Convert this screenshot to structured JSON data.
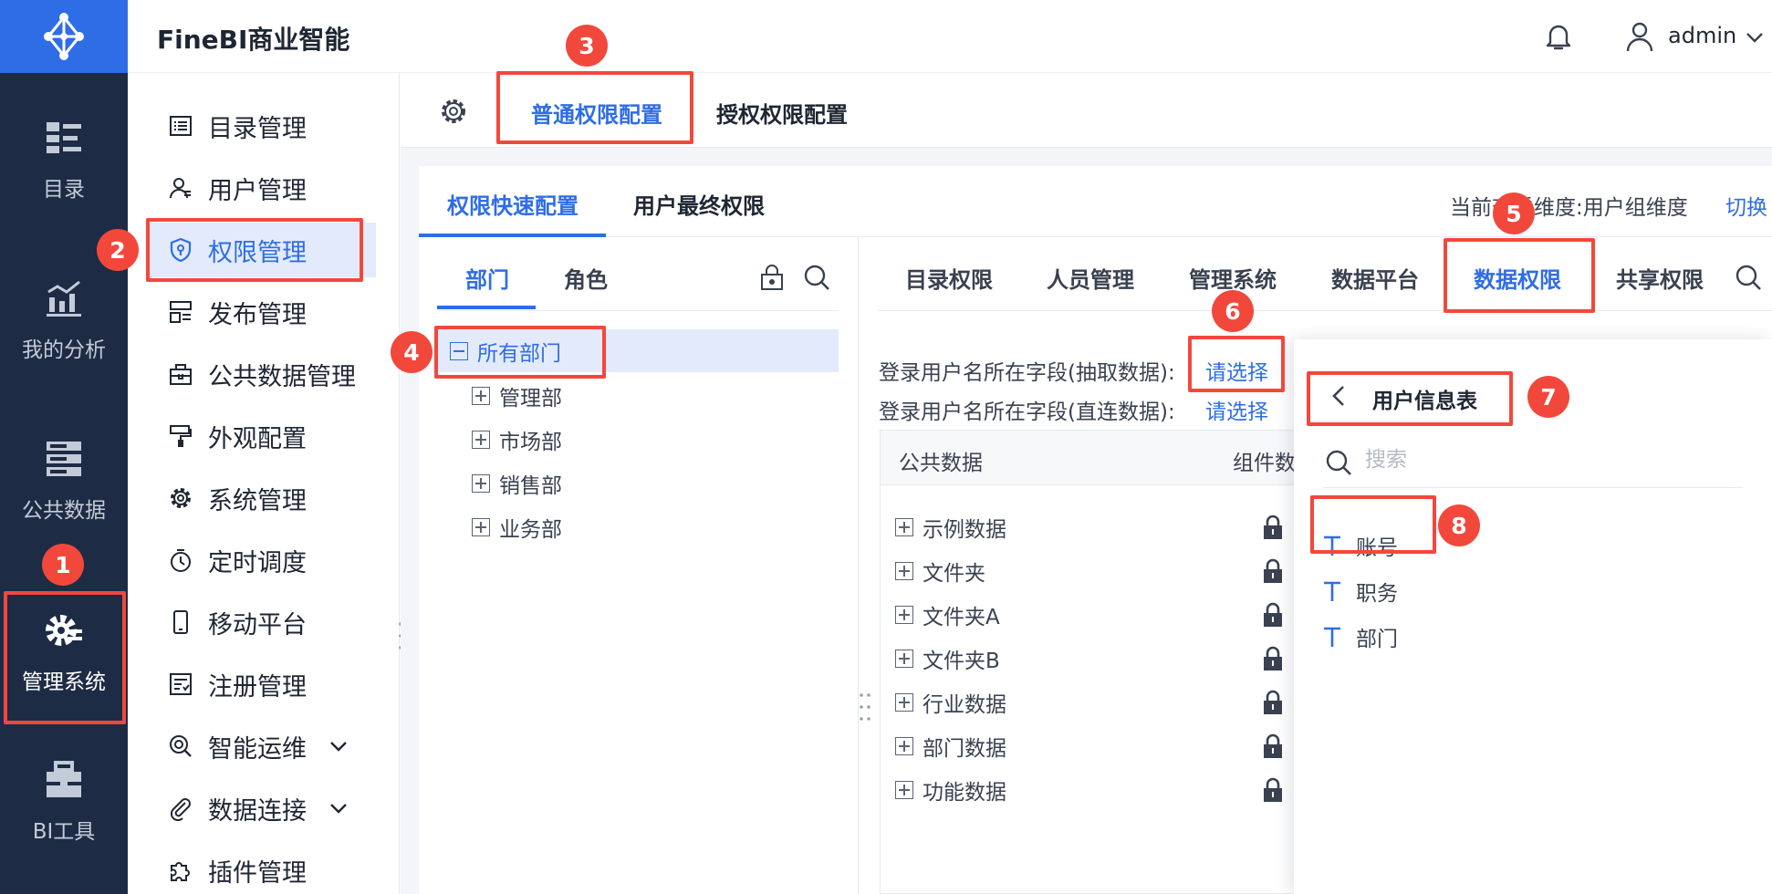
{
  "app": {
    "title": "FineBI商业智能"
  },
  "header": {
    "user_name": "admin"
  },
  "rail": {
    "items": [
      {
        "label": "目录",
        "icon": "catalog-icon"
      },
      {
        "label": "我的分析",
        "icon": "analysis-chart-icon"
      },
      {
        "label": "公共数据",
        "icon": "database-icon"
      },
      {
        "label": "管理系统",
        "icon": "gear-admin-icon"
      },
      {
        "label": "BI工具",
        "icon": "toolbox-icon"
      }
    ]
  },
  "menu": {
    "items": [
      {
        "label": "目录管理",
        "icon": "list-icon"
      },
      {
        "label": "用户管理",
        "icon": "user-icon"
      },
      {
        "label": "权限管理",
        "icon": "shield-key-icon"
      },
      {
        "label": "发布管理",
        "icon": "publish-icon"
      },
      {
        "label": "公共数据管理",
        "icon": "briefcase-icon"
      },
      {
        "label": "外观配置",
        "icon": "paint-roller-icon"
      },
      {
        "label": "系统管理",
        "icon": "gear-icon"
      },
      {
        "label": "定时调度",
        "icon": "stopwatch-icon"
      },
      {
        "label": "移动平台",
        "icon": "mobile-icon"
      },
      {
        "label": "注册管理",
        "icon": "register-icon"
      },
      {
        "label": "智能运维",
        "icon": "ops-icon"
      },
      {
        "label": "数据连接",
        "icon": "paperclip-icon"
      },
      {
        "label": "插件管理",
        "icon": "puzzle-icon"
      }
    ]
  },
  "topbar": {
    "tabs": [
      {
        "label": "普通权限配置"
      },
      {
        "label": "授权权限配置"
      }
    ]
  },
  "card": {
    "tabs": [
      {
        "label": "权限快速配置"
      },
      {
        "label": "用户最终权限"
      }
    ],
    "dimension_label": "当前查看维度:用户组维度",
    "dimension_switch": "切换"
  },
  "tree": {
    "tabs": [
      {
        "label": "部门"
      },
      {
        "label": "角色"
      }
    ],
    "root": "所有部门",
    "children": [
      "管理部",
      "市场部",
      "销售部",
      "业务部"
    ]
  },
  "perms": {
    "tabs": [
      {
        "label": "目录权限"
      },
      {
        "label": "人员管理"
      },
      {
        "label": "管理系统"
      },
      {
        "label": "数据平台"
      },
      {
        "label": "数据权限"
      },
      {
        "label": "共享权限"
      }
    ],
    "extract_label": "登录用户名所在字段(抽取数据):",
    "extract_link": "请选择",
    "direct_label": "登录用户名所在字段(直连数据):",
    "direct_link": "请选择",
    "table_title": "公共数据",
    "table_col2": "组件数",
    "rows": [
      "示例数据",
      "文件夹",
      "文件夹A",
      "文件夹B",
      "行业数据",
      "部门数据",
      "功能数据"
    ]
  },
  "chooser": {
    "title": "用户信息表",
    "search_placeholder": "搜索",
    "fields": [
      "账号",
      "职务",
      "部门"
    ]
  },
  "annotations": [
    "1",
    "2",
    "3",
    "4",
    "5",
    "6",
    "7",
    "8"
  ],
  "colors": {
    "primary": "#2f6de6",
    "rail_bg": "#1e2b45",
    "annotation": "#f2483c",
    "active_bg": "#e3eafc"
  }
}
